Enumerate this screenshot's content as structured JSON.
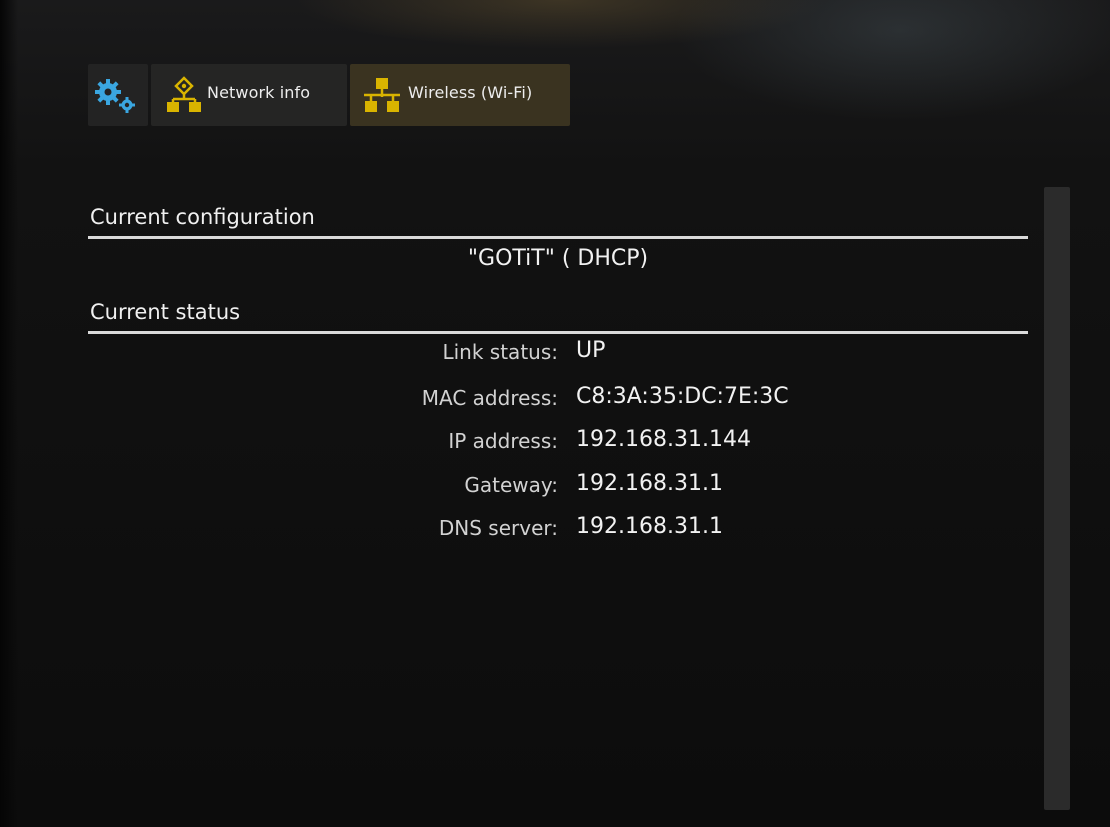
{
  "breadcrumb": {
    "items": [
      {
        "label": "Network info",
        "icon": "network-icon"
      },
      {
        "label": "Wireless (Wi-Fi)",
        "icon": "wifi-network-icon"
      }
    ],
    "settings_icon": "gears-icon"
  },
  "configuration": {
    "title": "Current configuration",
    "value": "\"GOTiT\" ( DHCP)"
  },
  "status": {
    "title": "Current status",
    "rows": [
      {
        "label": "Link status:",
        "value": "UP"
      },
      {
        "label": "MAC address:",
        "value": "C8:3A:35:DC:7E:3C"
      },
      {
        "label": "IP address:",
        "value": "192.168.31.144"
      },
      {
        "label": "Gateway:",
        "value": "192.168.31.1"
      },
      {
        "label": "DNS server:",
        "value": "192.168.31.1"
      }
    ]
  },
  "colors": {
    "gear_icon": "#3aa6e0",
    "network_icon": "#d9b400"
  }
}
